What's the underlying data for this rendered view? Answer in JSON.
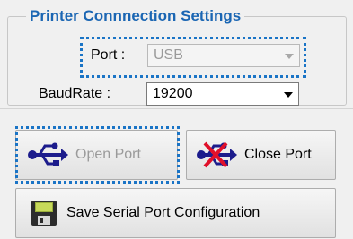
{
  "group": {
    "title": "Printer Connnection Settings",
    "port": {
      "label": "Port :",
      "value": "USB"
    },
    "baudrate": {
      "label": "BaudRate :",
      "value": "19200"
    }
  },
  "buttons": {
    "open_port": "Open Port",
    "close_port": "Close Port",
    "save_config": "Save Serial Port Configuration"
  },
  "icons": {
    "usb_color": "#1c1c8c",
    "cross_color": "#e0102a",
    "floppy_color": "#5a6e1e"
  },
  "colors": {
    "title": "#1b66b3",
    "focus": "#1a74c6"
  }
}
